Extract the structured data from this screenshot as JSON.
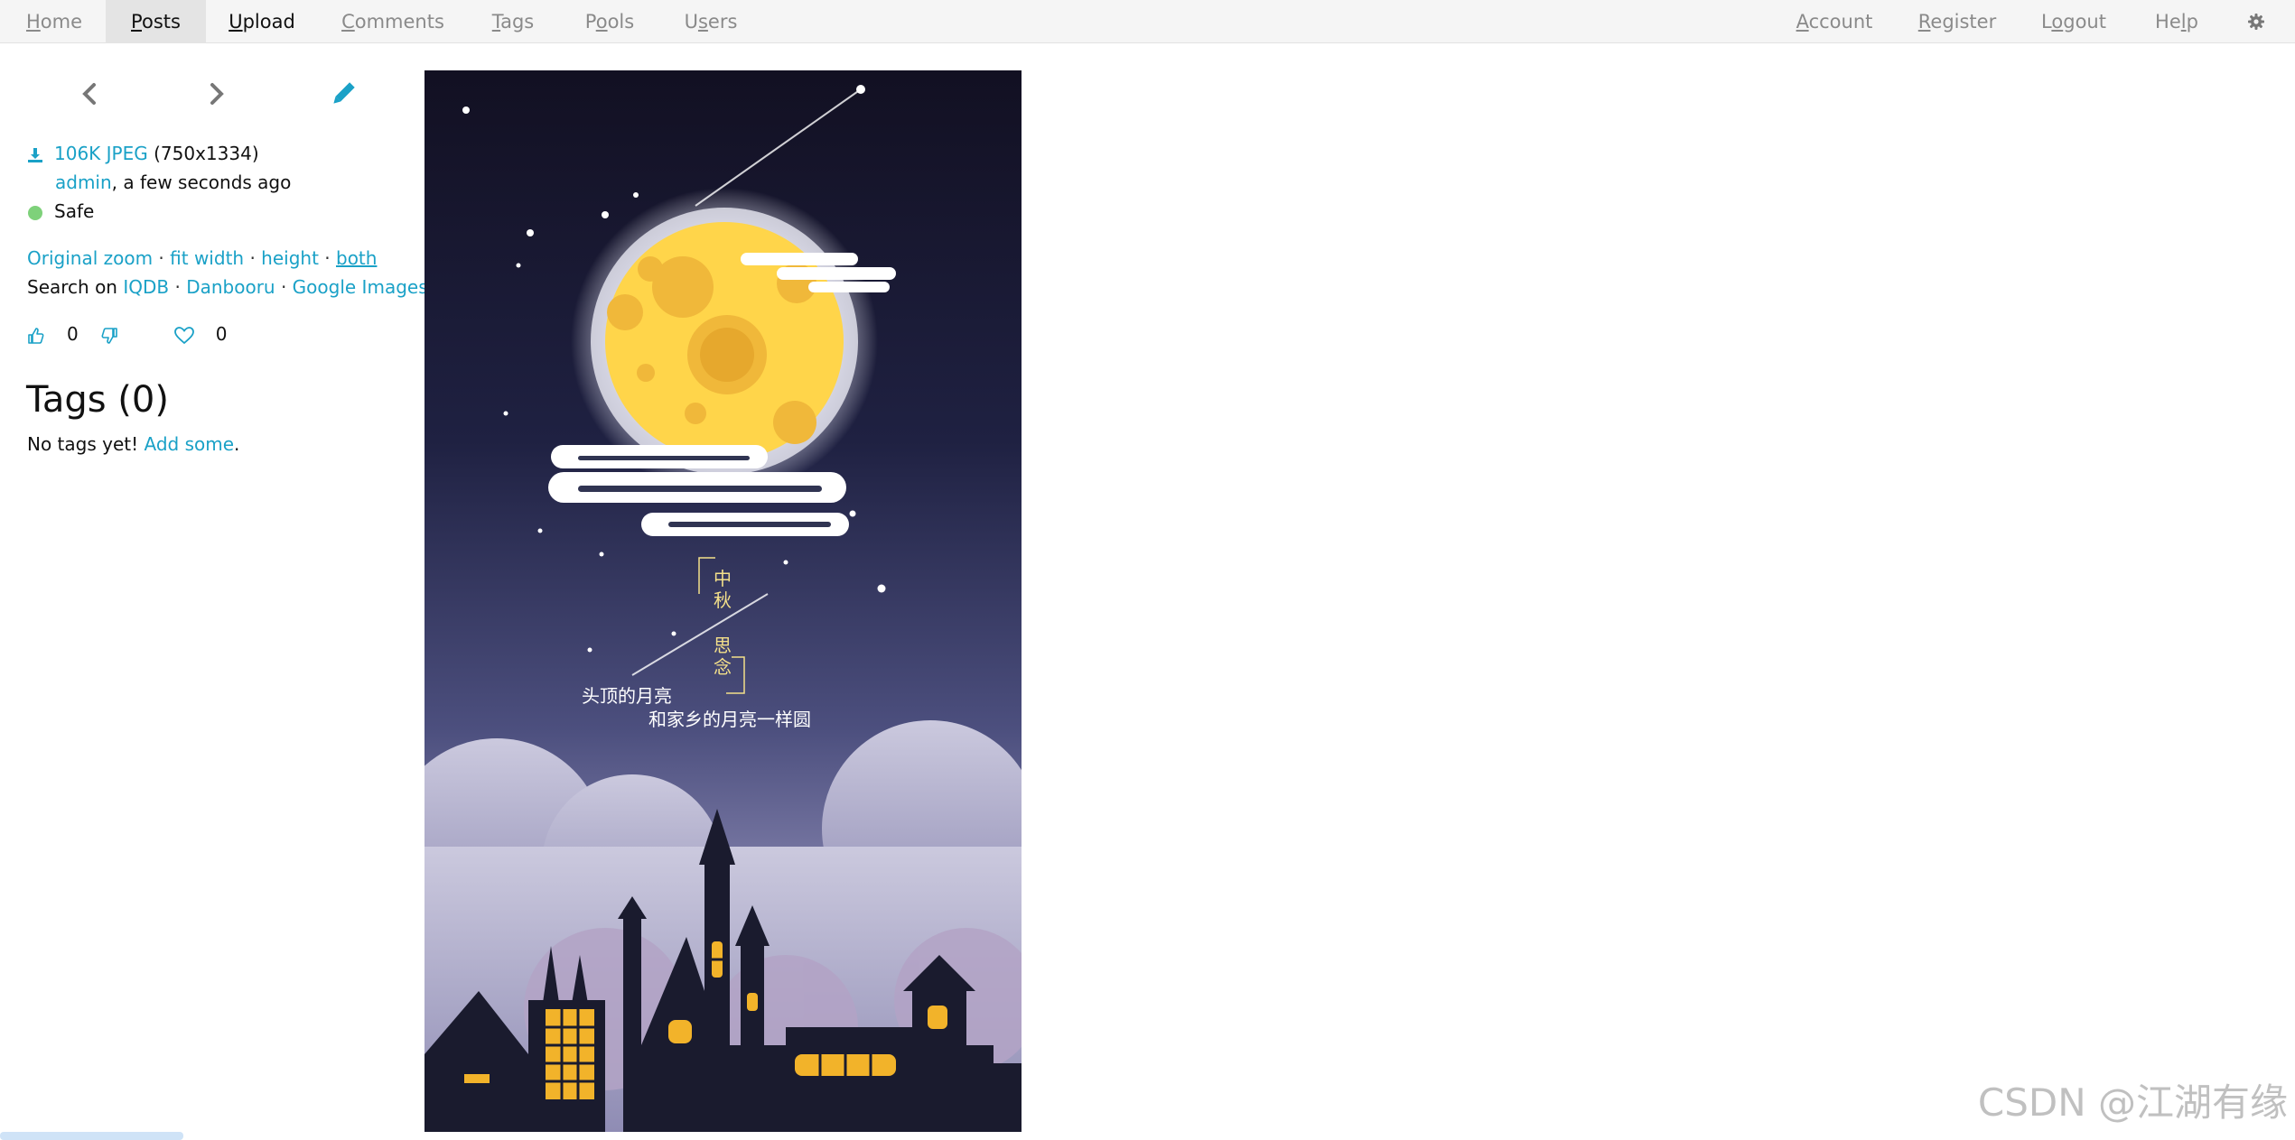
{
  "nav": {
    "left": [
      {
        "first": "H",
        "rest": "ome"
      },
      {
        "first": "P",
        "rest": "osts"
      },
      {
        "first": "U",
        "rest": "pload"
      },
      {
        "first": "C",
        "rest": "omments"
      },
      {
        "first": "T",
        "rest": "ags"
      },
      {
        "first": "P",
        "rest": "ools",
        "pre": ""
      },
      {
        "first": "U",
        "rest": "sers"
      }
    ],
    "right": [
      {
        "first": "A",
        "rest": "ccount"
      },
      {
        "first": "R",
        "rest": "egister"
      },
      {
        "first": "L",
        "rest": "ogout"
      },
      {
        "first": "H",
        "rest": "elp"
      }
    ],
    "pools": {
      "pre": "P",
      "acc": "o",
      "rest": "ols"
    },
    "users": {
      "pre": "U",
      "acc": "s",
      "rest": "ers"
    },
    "logout": {
      "pre": "L",
      "acc": "o",
      "rest": "gout"
    },
    "help": {
      "pre": "He",
      "acc": "l",
      "rest": "p"
    }
  },
  "post": {
    "file_link": "106K JPEG",
    "dimensions": "(750x1334)",
    "uploader": "admin",
    "uploaded_suffix": ", a few seconds ago",
    "safety": "Safe",
    "zoom": {
      "original": "Original zoom",
      "fit_width": "fit width",
      "height": "height",
      "both": "both"
    },
    "search_label": "Search on ",
    "search": {
      "iqdb": "IQDB",
      "danbooru": "Danbooru",
      "google": "Google Images"
    },
    "dot": " · ",
    "score": "0",
    "favorites": "0"
  },
  "tags": {
    "title": "Tags (0)",
    "empty_prefix": "No tags yet! ",
    "add_link": "Add some",
    "empty_suffix": "."
  },
  "image": {
    "caption_title": [
      "中",
      "秋",
      "思",
      "念"
    ],
    "line1": "头顶的月亮",
    "line2": "和家乡的月亮一样圆"
  },
  "watermark": "CSDN @江湖有缘",
  "colors": {
    "link": "#1aa1c7",
    "safe": "#7ed17a",
    "nav_active": "#e4e4e4"
  }
}
